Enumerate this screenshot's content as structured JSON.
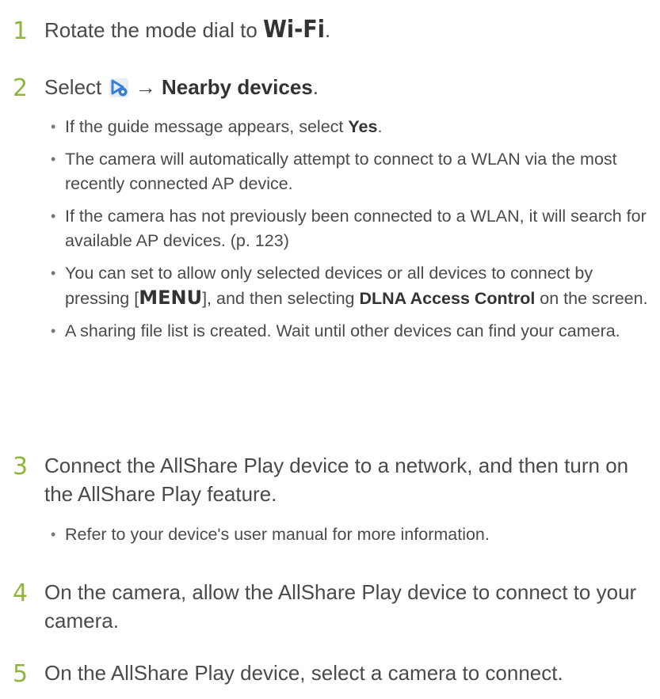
{
  "steps": [
    {
      "number": "1",
      "text_before": "Rotate the mode dial to ",
      "mode": "Wi-Fi",
      "text_after": "."
    },
    {
      "number": "2",
      "text_before": "Select ",
      "icon": "allshare-play-icon",
      "arrow": " → ",
      "bold": "Nearby devices",
      "text_after": ".",
      "bullets": [
        {
          "before": "If the guide message appears, select ",
          "bold": "Yes",
          "after": "."
        },
        {
          "text": "The camera will automatically attempt to connect to a WLAN via the most recently connected AP device."
        },
        {
          "text": "If the camera has not previously been connected to a WLAN, it will search for available AP devices. (p. 123)"
        },
        {
          "before": "You can set to allow only selected devices or all devices to connect by pressing [",
          "key": "MENU",
          "middle": "], and then selecting ",
          "bold": "DLNA Access Control",
          "after": " on the screen."
        },
        {
          "text": "A sharing file list is created. Wait until other devices can find your camera."
        }
      ]
    },
    {
      "number": "3",
      "text": "Connect the AllShare Play device to a network, and then turn on the AllShare Play feature.",
      "bullets": [
        {
          "text": "Refer to your device's user manual for more information."
        }
      ]
    },
    {
      "number": "4",
      "text": "On the camera, allow the AllShare Play device to connect to your camera."
    },
    {
      "number": "5",
      "text": "On the AllShare Play device, select a camera to connect."
    }
  ],
  "bullet_char": "•",
  "colors": {
    "step_number": "#8fb63b",
    "body_text": "#4a4a4a",
    "icon_blue": "#3a7fd6"
  }
}
